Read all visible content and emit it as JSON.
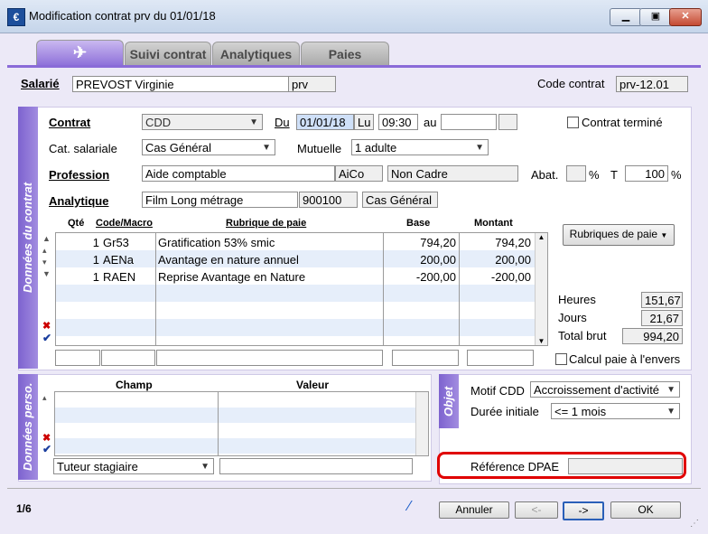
{
  "window": {
    "title": "Modification contrat prv du 01/01/18",
    "icon_glyph": "€"
  },
  "tabs": [
    {
      "label": ""
    },
    {
      "label": "Suivi contrat"
    },
    {
      "label": "Analytiques"
    },
    {
      "label": "Paies"
    }
  ],
  "header": {
    "salarie_label": "Salarié",
    "salarie_name": "PREVOST Virginie",
    "salarie_code": "prv",
    "code_contrat_label": "Code contrat",
    "code_contrat_value": "prv-12.01"
  },
  "contract": {
    "section_title": "Données du contrat",
    "contrat_label": "Contrat",
    "contrat_value": "CDD",
    "du_label": "Du",
    "du_date": "01/01/18",
    "du_day": "Lu",
    "du_time": "09:30",
    "au_label": "au",
    "au_date": "",
    "au_extra": "",
    "contrat_termine_label": "Contrat terminé",
    "cat_label": "Cat. salariale",
    "cat_value": "Cas Général",
    "mutuelle_label": "Mutuelle",
    "mutuelle_value": "1 adulte",
    "profession_label": "Profession",
    "profession_value": "Aide comptable",
    "profession_code": "AiCo",
    "profession_status": "Non Cadre",
    "abat_label": "Abat.",
    "abat_value": "",
    "pct1": "%",
    "t_label": "T",
    "t_value": "100",
    "pct2": "%",
    "analytique_label": "Analytique",
    "analytique_value": "Film Long métrage",
    "analytique_code": "900100",
    "analytique_cas": "Cas Général"
  },
  "grid": {
    "columns": [
      "Qté",
      "Code/Macro",
      "Rubrique de paie",
      "Base",
      "Montant"
    ],
    "rows": [
      {
        "qte": "1",
        "code": "Gr53",
        "rubrique": "Gratification 53% smic",
        "base": "794,20",
        "montant": "794,20"
      },
      {
        "qte": "1",
        "code": "AENa",
        "rubrique": "Avantage en nature annuel",
        "base": "200,00",
        "montant": "200,00"
      },
      {
        "qte": "1",
        "code": "RAEN",
        "rubrique": "Reprise Avantage en Nature",
        "base": "-200,00",
        "montant": "-200,00"
      }
    ],
    "rubriques_button": "Rubriques de paie",
    "calcul_envers_label": "Calcul paie à l'envers"
  },
  "totals": {
    "heures_label": "Heures",
    "heures_value": "151,67",
    "jours_label": "Jours",
    "jours_value": "21,67",
    "brut_label": "Total brut",
    "brut_value": "994,20"
  },
  "perso": {
    "section_title": "Données perso.",
    "columns": [
      "Champ",
      "Valeur"
    ],
    "select_value": "Tuteur stagiaire",
    "input_value": ""
  },
  "objet": {
    "section_title": "Objet",
    "motif_label": "Motif CDD",
    "motif_value": "Accroissement d'activité",
    "duree_label": "Durée initiale",
    "duree_value": "<= 1 mois",
    "dpae_label": "Référence DPAE",
    "dpae_value": ""
  },
  "footer": {
    "page": "1/6",
    "annuler": "Annuler",
    "prev": "<-",
    "next": "->",
    "ok": "OK"
  },
  "colors": {
    "accent": "#8a6bd8",
    "highlight": "#e00000"
  }
}
